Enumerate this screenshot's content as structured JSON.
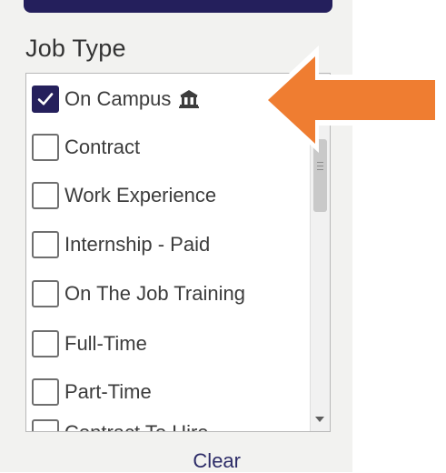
{
  "filter": {
    "title": "Job Type",
    "clear_label": "Clear",
    "items": [
      {
        "label": "On Campus",
        "checked": true,
        "icon": "building-icon"
      },
      {
        "label": "Contract",
        "checked": false
      },
      {
        "label": "Work Experience",
        "checked": false
      },
      {
        "label": "Internship - Paid",
        "checked": false
      },
      {
        "label": "On The Job Training",
        "checked": false
      },
      {
        "label": "Full-Time",
        "checked": false
      },
      {
        "label": "Part-Time",
        "checked": false
      },
      {
        "label": "Contract To Hire",
        "checked": false
      }
    ]
  },
  "colors": {
    "accent": "#241f5c",
    "arrow": "#ef7d31"
  }
}
